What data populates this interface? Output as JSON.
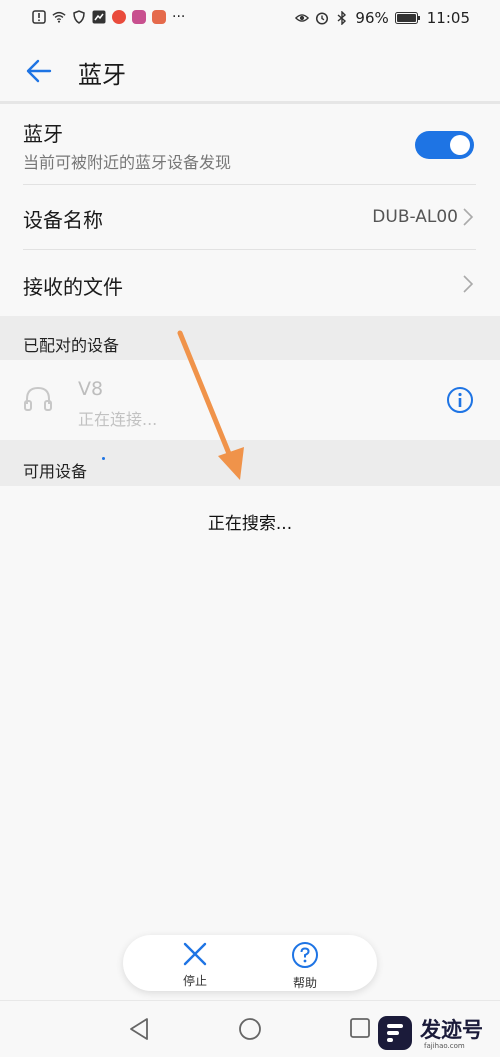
{
  "status_bar": {
    "battery": "96%",
    "time": "11:05",
    "app_colors": [
      "#e94b3c",
      "#c8508f",
      "#e56a4b"
    ]
  },
  "header": {
    "title": "蓝牙"
  },
  "bluetooth": {
    "label": "蓝牙",
    "sub": "当前可被附近的蓝牙设备发现",
    "enabled": true
  },
  "device_name": {
    "label": "设备名称",
    "value": "DUB-AL00"
  },
  "received_files": {
    "label": "接收的文件"
  },
  "paired_section": {
    "label": "已配对的设备"
  },
  "paired_device": {
    "name": "V8",
    "status": "正在连接..."
  },
  "available_section": {
    "label": "可用设备"
  },
  "searching": "正在搜索...",
  "bottom_bar": {
    "stop": "停止",
    "help": "帮助"
  },
  "watermark": {
    "text": "发迹号",
    "small": "fajihao.com"
  },
  "colors": {
    "accent": "#1e74e4",
    "arrow": "#f0934a"
  }
}
